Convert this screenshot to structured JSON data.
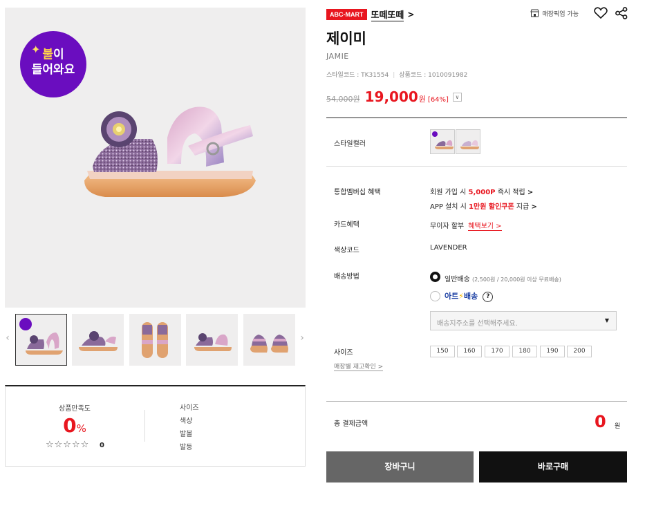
{
  "gallery": {
    "badge": {
      "line1_highlight": "불",
      "line1_rest": "이",
      "line2": "들어와요"
    },
    "thumb_badge": "불이 들어와요",
    "prev_arrow": "‹",
    "next_arrow": "›"
  },
  "review": {
    "satisfaction_label": "상품만족도",
    "satisfaction_value": "0",
    "satisfaction_unit": "%",
    "stars": "☆☆☆☆☆",
    "review_count": "0",
    "attributes": [
      "사이즈",
      "색상",
      "발볼",
      "발등"
    ]
  },
  "brand": {
    "logo": "ABC-MART",
    "name": "또떼또떼",
    "chevron": ">"
  },
  "actions": {
    "store_pickup": "매장픽업 가능"
  },
  "product": {
    "name": "제이미",
    "name_en": "JAMIE",
    "style_code_label": "스타일코드 : TK31554",
    "product_code_label": "상품코드 : 1010091982",
    "separator": "|",
    "original_price": "54,000원",
    "sale_price": "19,000",
    "sale_unit": "원",
    "discount_rate": "[64%]",
    "price_toggle": "∨"
  },
  "info": {
    "style_color_label": "스타일컬러",
    "membership_label": "통합멤버십 혜택",
    "membership_line1": {
      "pre": "회원 가입 시 ",
      "red": "5,000P",
      "post": " 즉시 적립 ",
      "arrow": ">"
    },
    "membership_line2": {
      "pre": "APP 설치 시 ",
      "red": "1만원 할인쿠폰",
      "post": " 지급 ",
      "arrow": ">"
    },
    "card_label": "카드혜택",
    "card_value": "무이자 할부",
    "card_link": "혜택보기 >",
    "color_code_label": "색상코드",
    "color_code_value": "LAVENDER",
    "shipping_label": "배송방법",
    "ship_standard": "일반배송",
    "ship_standard_note": "(2,500원 / 20,000원 이상 무료배송)",
    "ship_art": {
      "a": "아트",
      "bolt": "⚡",
      "b": "배송"
    },
    "ship_help": "?",
    "store_select_placeholder": "배송지주소를 선택해주세요.",
    "select_caret": "▼",
    "size_label": "사이즈",
    "sizes": [
      "150",
      "160",
      "170",
      "180",
      "190",
      "200"
    ],
    "store_stock_link": "매장별 재고확인 >"
  },
  "total": {
    "label": "총 결제금액",
    "value": "0",
    "unit": "원"
  },
  "buttons": {
    "cart": "장바구니",
    "buy": "바로구매"
  },
  "colors": {
    "accent_red": "#e8161f",
    "badge_purple": "#6a0dbf",
    "cart_button": "#666666",
    "buy_button": "#111111"
  }
}
